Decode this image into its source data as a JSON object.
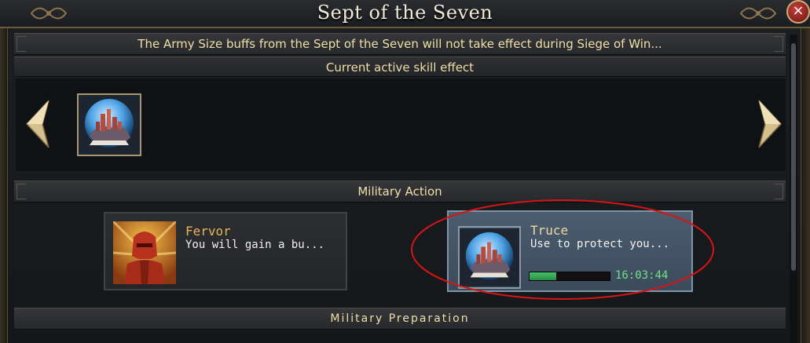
{
  "window": {
    "title": "Sept of the Seven",
    "close_label": "×"
  },
  "notice": {
    "text": "The Army Size buffs from the Sept of the Seven will not take effect during Siege of Win..."
  },
  "current_effects": {
    "header": "Current active skill effect",
    "skills": [
      {
        "name": "Truce",
        "icon": "fortress-globe-icon"
      }
    ]
  },
  "military_action": {
    "header": "Military Action",
    "actions": [
      {
        "name": "Fervor",
        "description": "You will gain a bu...",
        "icon": "knight-helmet-icon",
        "active": false
      },
      {
        "name": "Truce",
        "description": "Use to protect you...",
        "icon": "fortress-globe-icon",
        "active": true,
        "progress": 0.33,
        "timer": "16:03:44"
      }
    ]
  },
  "military_preparation": {
    "header": "Military Preparation"
  },
  "colors": {
    "accent_gold": "#f0dfa8",
    "name_gold": "#e9b65a",
    "timer_green": "#6fe08a",
    "active_card": "#4c5d70",
    "highlight_red": "#d81414"
  }
}
